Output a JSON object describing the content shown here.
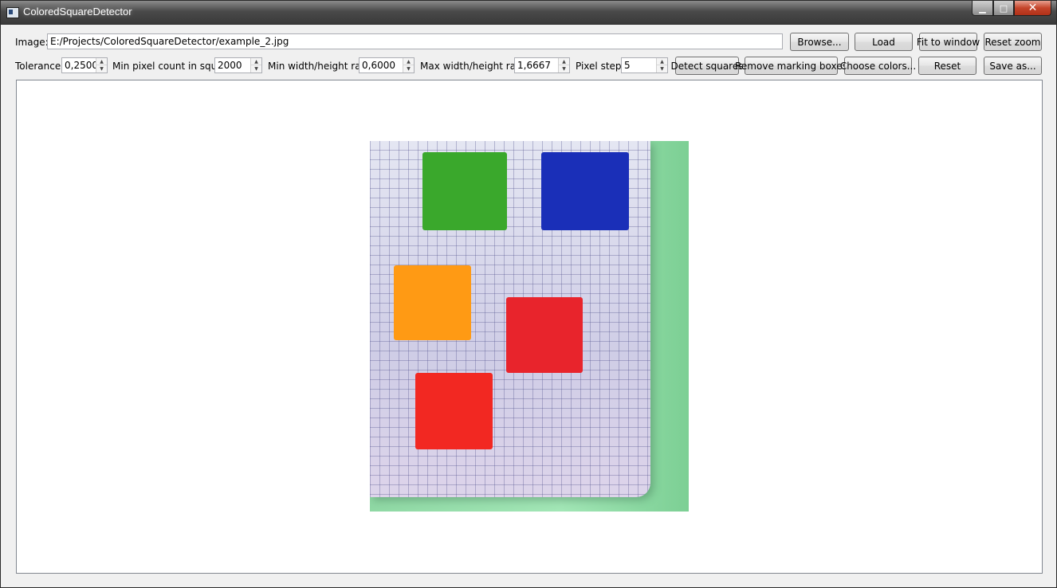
{
  "window": {
    "title": "ColoredSquareDetector",
    "buttons": {
      "minimize": "▁",
      "maximize": "□",
      "close": "✕"
    }
  },
  "toolbar": {
    "image_label": "Image:",
    "image_path": "E:/Projects/ColoredSquareDetector/example_2.jpg",
    "browse_label": "Browse...",
    "load_label": "Load",
    "fit_label": "Fit to window",
    "reset_zoom_label": "Reset zoom"
  },
  "params": {
    "tolerance_label": "Tolerance:",
    "tolerance_value": "0,2500",
    "min_pixel_label": "Min pixel count in square:",
    "min_pixel_value": "2000",
    "min_ratio_label": "Min width/height ratio:",
    "min_ratio_value": "0,6000",
    "max_ratio_label": "Max width/height ratio:",
    "max_ratio_value": "1,6667",
    "pixel_step_label": "Pixel step:",
    "pixel_step_value": "5",
    "detect_label": "Detect squares",
    "remove_label": "Remove marking boxes",
    "choose_colors_label": "Choose colors...",
    "reset_label": "Reset",
    "save_label": "Save as..."
  },
  "colors": {
    "green_square": "#3aa82c",
    "blue_square": "#1a2fb8",
    "orange_square": "#ff9a14",
    "red_square": "#e8242c"
  }
}
